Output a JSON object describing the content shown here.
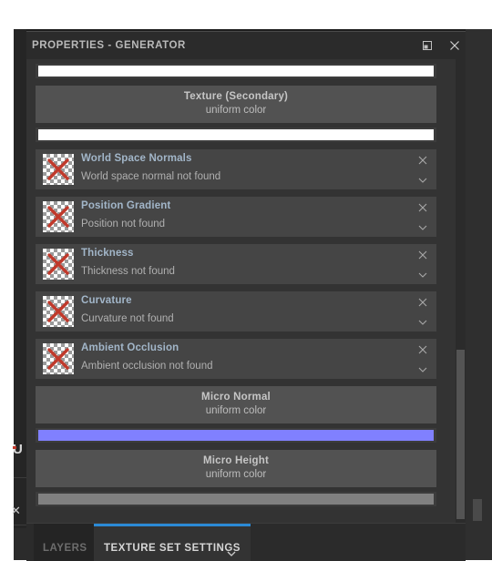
{
  "panel": {
    "title": "PROPERTIES - GENERATOR",
    "dock_icon": "dock-float-icon",
    "close_icon": "close-icon"
  },
  "channels": [
    {
      "kind": "swatch",
      "name": "texture-primary-color-swatch",
      "color": "#ffffff"
    },
    {
      "kind": "uniform",
      "title": "Texture (Secondary)",
      "subtitle": "uniform color"
    },
    {
      "kind": "swatch",
      "name": "texture-secondary-color-swatch",
      "color": "#ffffff"
    },
    {
      "kind": "resource",
      "title": "World Space Normals",
      "status": "World space normal not found",
      "thumb_icon": "missing-texture-icon",
      "clear_icon": "close-icon",
      "expand_icon": "chevron-down-icon"
    },
    {
      "kind": "resource",
      "title": "Position Gradient",
      "status": "Position not found",
      "thumb_icon": "missing-texture-icon",
      "clear_icon": "close-icon",
      "expand_icon": "chevron-down-icon"
    },
    {
      "kind": "resource",
      "title": "Thickness",
      "status": "Thickness not found",
      "thumb_icon": "missing-texture-icon",
      "clear_icon": "close-icon",
      "expand_icon": "chevron-down-icon"
    },
    {
      "kind": "resource",
      "title": "Curvature",
      "status": "Curvature not found",
      "thumb_icon": "missing-texture-icon",
      "clear_icon": "close-icon",
      "expand_icon": "chevron-down-icon"
    },
    {
      "kind": "resource",
      "title": "Ambient Occlusion",
      "status": "Ambient occlusion not found",
      "thumb_icon": "missing-texture-icon",
      "clear_icon": "close-icon",
      "expand_icon": "chevron-down-icon"
    },
    {
      "kind": "uniform",
      "title": "Micro Normal",
      "subtitle": "uniform color"
    },
    {
      "kind": "swatch",
      "name": "micro-normal-color-swatch",
      "color": "#8080ff"
    },
    {
      "kind": "uniform",
      "title": "Micro Height",
      "subtitle": "uniform color"
    },
    {
      "kind": "swatch",
      "name": "micro-height-color-swatch",
      "color": "#808080"
    }
  ],
  "bottom_dock": {
    "tabs": [
      {
        "label": "LAYERS",
        "active": false
      },
      {
        "label": "TEXTURE SET SETTINGS",
        "active": true
      }
    ],
    "menu_icon": "chevron-down-icon"
  },
  "background": {
    "left_glyph": "U",
    "left_glyph_x": "✕"
  },
  "colors": {
    "panel_bg": "#333333",
    "titlebar_bg": "#2b2b2b",
    "row_bg": "#454545",
    "uniform_bg": "#525252",
    "accent_blue": "#2b8ad6",
    "title_text": "#b9b9b9",
    "resource_title": "#a2b6c9",
    "missing_x": "#c0392b"
  }
}
